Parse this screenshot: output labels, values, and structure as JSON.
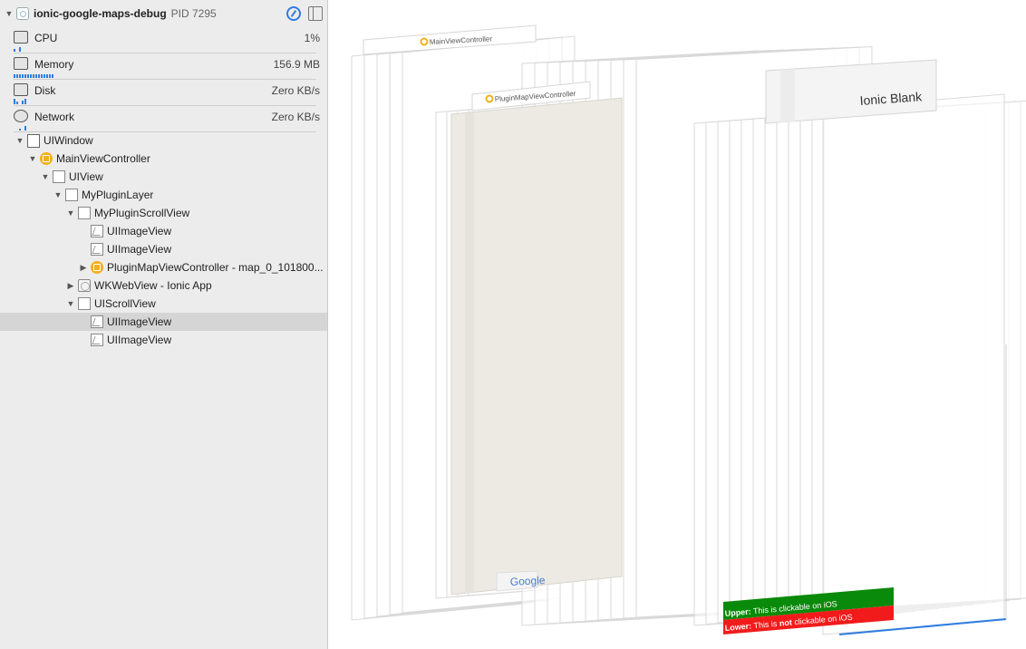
{
  "process": {
    "name": "ionic-google-maps-debug",
    "pid": "PID 7295"
  },
  "gauges": [
    {
      "label": "CPU",
      "value": "1%",
      "icon": "cpu-icon"
    },
    {
      "label": "Memory",
      "value": "156.9 MB",
      "icon": "memory-icon"
    },
    {
      "label": "Disk",
      "value": "Zero KB/s",
      "icon": "disk-icon"
    },
    {
      "label": "Network",
      "value": "Zero KB/s",
      "icon": "network-icon"
    }
  ],
  "tree": [
    {
      "label": "UIWindow",
      "depth": 0,
      "expand": "open",
      "icon": "window-icon",
      "kind": "window"
    },
    {
      "label": "MainViewController",
      "depth": 1,
      "expand": "open",
      "icon": "view-controller-icon",
      "kind": "controller"
    },
    {
      "label": "UIView",
      "depth": 2,
      "expand": "open",
      "icon": "view-icon",
      "kind": "view"
    },
    {
      "label": "MyPluginLayer",
      "depth": 3,
      "expand": "open",
      "icon": "view-icon",
      "kind": "view"
    },
    {
      "label": "MyPluginScrollView",
      "depth": 4,
      "expand": "open",
      "icon": "view-icon",
      "kind": "view"
    },
    {
      "label": "UIImageView",
      "depth": 5,
      "expand": "none",
      "icon": "image-view-icon",
      "kind": "image"
    },
    {
      "label": "UIImageView",
      "depth": 5,
      "expand": "none",
      "icon": "image-view-icon",
      "kind": "image"
    },
    {
      "label": "PluginMapViewController - map_0_101800...",
      "depth": 5,
      "expand": "closed",
      "icon": "view-controller-icon",
      "kind": "controller"
    },
    {
      "label": "WKWebView - Ionic App",
      "depth": 4,
      "expand": "closed",
      "icon": "web-view-icon",
      "kind": "web"
    },
    {
      "label": "UIScrollView",
      "depth": 4,
      "expand": "open",
      "icon": "view-icon",
      "kind": "view"
    },
    {
      "label": "UIImageView",
      "depth": 5,
      "expand": "none",
      "icon": "image-view-icon",
      "kind": "image",
      "selected": true
    },
    {
      "label": "UIImageView",
      "depth": 5,
      "expand": "none",
      "icon": "image-view-icon",
      "kind": "image"
    }
  ],
  "canvas": {
    "main_view_controller_label": "MainViewController",
    "plugin_map_view_controller_label": "PluginMapViewController",
    "ionic_title": "Ionic Blank",
    "google_logo": "Google",
    "upper_banner": {
      "bold": "Upper:",
      "text": " This is clickable on iOS",
      "color": "#0a8a0a"
    },
    "lower_banner": {
      "bold": "Lower:",
      "text": " This is ",
      "bold2": "not",
      "text2": " clickable on iOS",
      "color": "#f21b1b"
    }
  }
}
